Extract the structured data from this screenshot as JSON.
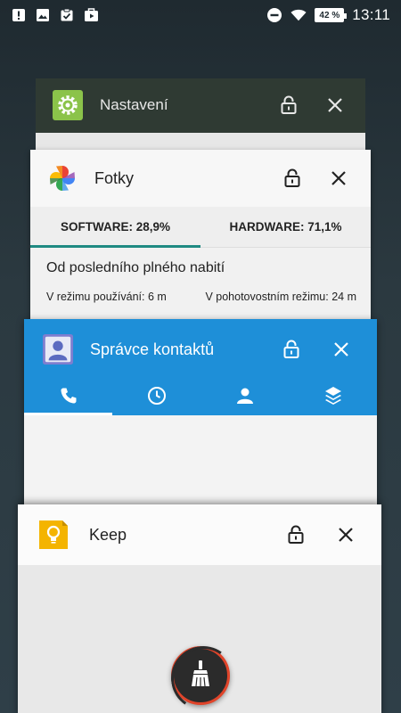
{
  "status_bar": {
    "battery": "42 %",
    "time": "13:11",
    "left_icons": [
      "notification-alert-icon",
      "gallery-icon",
      "task-check-icon",
      "video-bag-icon"
    ],
    "right_icons": [
      "dnd-icon",
      "wifi-icon",
      "battery-icon"
    ]
  },
  "cards": {
    "nastaveni": {
      "title": "Nastavení",
      "icon": "settings-gear-icon",
      "accent": "#8bc34a"
    },
    "fotky": {
      "title": "Fotky",
      "icon": "google-photos-icon",
      "tabs": [
        "SOFTWARE: 28,9%",
        "HARDWARE: 71,1%"
      ],
      "since_label": "Od posledního plného nabití",
      "usage_active": "V režimu používání: 6 m",
      "usage_standby": "V pohotovostním režimu: 24 m",
      "accent": "#1f8a82"
    },
    "kontakty": {
      "title": "Správce kontaktů",
      "icon": "contacts-icon",
      "tabs": [
        "phone-icon",
        "clock-icon",
        "person-icon",
        "layers-icon"
      ],
      "accent": "#1e8fd8"
    },
    "keep": {
      "title": "Keep",
      "icon": "keep-bulb-icon",
      "accent": "#f4b400"
    }
  },
  "clear_all": {
    "icon": "broom-icon",
    "ring_color": "#e0442a"
  }
}
